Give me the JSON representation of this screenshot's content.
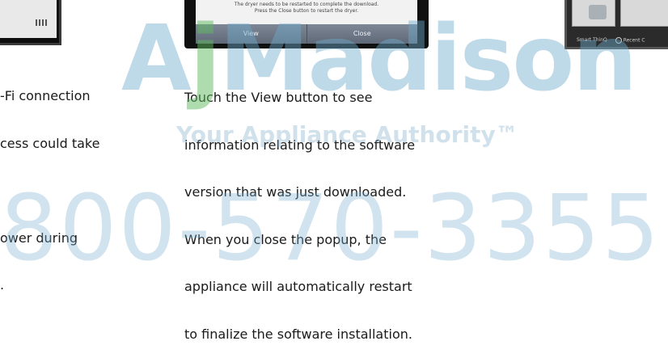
{
  "left": {
    "paragraph1": [
      "-Fi connection",
      "cess could take"
    ],
    "paragraph2": [
      "ower during",
      "."
    ]
  },
  "popup": {
    "message_line1": "The dryer needs to be restarted to complete the download.",
    "message_line2": "Press the Close button to restart the dryer.",
    "view_label": "View",
    "close_label": "Close"
  },
  "center_text": [
    "Touch the View button to see",
    "information relating to the software",
    "version that was just downloaded.",
    "When you close the popup, the",
    "appliance will automatically restart",
    "to finalize the software installation."
  ],
  "right_menu": {
    "smart_thinq": "Smart ThinQ",
    "recent": "Recent C"
  },
  "watermark": {
    "brand_a": "A",
    "brand_j": "j",
    "brand_rest": "Madison",
    "tagline": "Your Appliance Authority™",
    "phone": "800-570-3355"
  }
}
